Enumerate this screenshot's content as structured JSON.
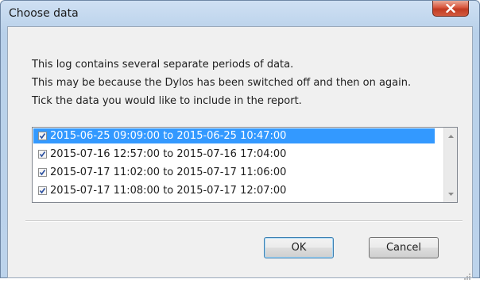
{
  "window": {
    "title": "Choose data",
    "close_glyph": "X"
  },
  "message": {
    "line1": "This log contains several separate periods of data.",
    "line2": "This may be because the Dylos has been switched off and then on again.",
    "line3": "Tick the data you would like to include in the report."
  },
  "periods": [
    {
      "label": "2015-06-25 09:09:00 to 2015-06-25 10:47:00",
      "checked": true,
      "selected": true
    },
    {
      "label": "2015-07-16 12:57:00 to 2015-07-16 17:04:00",
      "checked": true,
      "selected": false
    },
    {
      "label": "2015-07-17 11:02:00 to 2015-07-17 11:06:00",
      "checked": true,
      "selected": false
    },
    {
      "label": "2015-07-17 11:08:00 to 2015-07-17 12:07:00",
      "checked": true,
      "selected": false
    }
  ],
  "buttons": {
    "ok": "OK",
    "cancel": "Cancel"
  },
  "colors": {
    "selection": "#3399ff",
    "close_button": "#c13b22"
  },
  "icons": {
    "close": "close-icon",
    "scroll_up": "scroll-up-arrow-icon",
    "scroll_down": "scroll-down-arrow-icon",
    "checkmark": "checkmark-icon",
    "resize": "resize-grip-icon"
  }
}
